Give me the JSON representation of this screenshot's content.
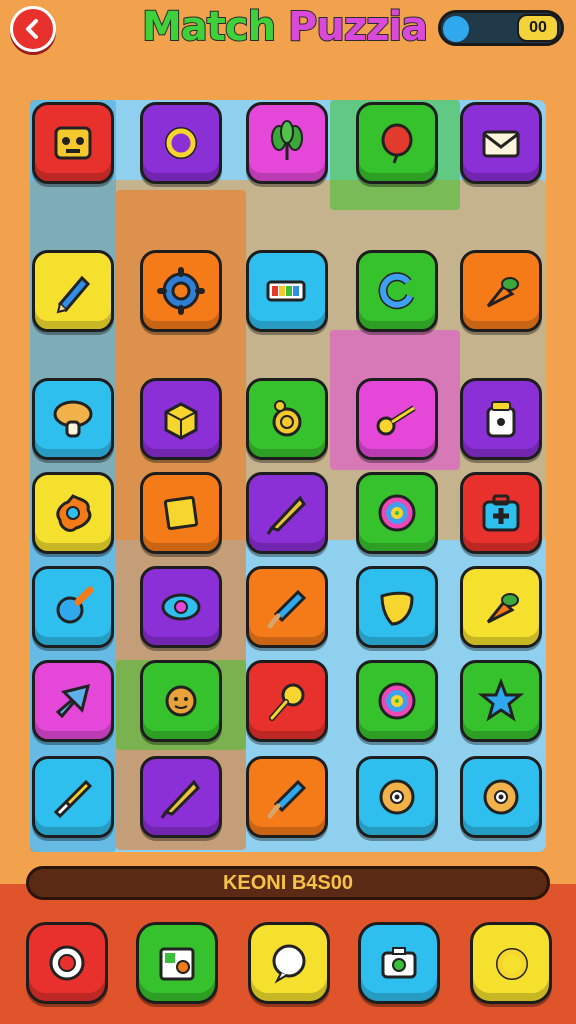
{
  "header": {
    "title_part1": "Match ",
    "title_part2": "Puzzia",
    "back_icon": "chevron-left-icon",
    "counter": "00",
    "progress_fraction": 0.1
  },
  "colors": {
    "red": "#e8312c",
    "purple": "#8b2fd6",
    "magenta": "#e548d9",
    "green": "#36c22c",
    "yellow": "#f5e02e",
    "cyan": "#2fbfee",
    "orange": "#f57a18",
    "pink": "#ef47b5"
  },
  "status_text": "KEONI B4S00",
  "tiles": [
    {
      "row": 0,
      "col": 0,
      "color": "red",
      "icon": "block-face-icon"
    },
    {
      "row": 0,
      "col": 1,
      "color": "purple",
      "icon": "ring-icon"
    },
    {
      "row": 0,
      "col": 2,
      "color": "magenta",
      "icon": "leaf-plant-icon"
    },
    {
      "row": 0,
      "col": 3,
      "color": "green",
      "icon": "balloon-icon"
    },
    {
      "row": 0,
      "col": 4,
      "color": "purple",
      "icon": "envelope-icon"
    },
    {
      "row": 1,
      "col": 0,
      "color": "yellow",
      "icon": "pencil-icon"
    },
    {
      "row": 1,
      "col": 1,
      "color": "orange",
      "icon": "gear-icon"
    },
    {
      "row": 1,
      "col": 2,
      "color": "cyan",
      "icon": "battery-icon"
    },
    {
      "row": 1,
      "col": 3,
      "color": "green",
      "icon": "swirl-c-icon"
    },
    {
      "row": 1,
      "col": 4,
      "color": "orange",
      "icon": "carrot-icon"
    },
    {
      "row": 2,
      "col": 0,
      "color": "cyan",
      "icon": "mushroom-icon"
    },
    {
      "row": 2,
      "col": 1,
      "color": "purple",
      "icon": "box-icon"
    },
    {
      "row": 2,
      "col": 2,
      "color": "green",
      "icon": "snail-icon"
    },
    {
      "row": 2,
      "col": 3,
      "color": "magenta",
      "icon": "key-icon"
    },
    {
      "row": 2,
      "col": 4,
      "color": "purple",
      "icon": "jar-icon"
    },
    {
      "row": 3,
      "col": 0,
      "color": "yellow",
      "icon": "splat-icon"
    },
    {
      "row": 3,
      "col": 1,
      "color": "orange",
      "icon": "note-icon"
    },
    {
      "row": 3,
      "col": 2,
      "color": "purple",
      "icon": "kite-icon"
    },
    {
      "row": 3,
      "col": 3,
      "color": "green",
      "icon": "lollipop-icon"
    },
    {
      "row": 3,
      "col": 4,
      "color": "red",
      "icon": "first-aid-icon"
    },
    {
      "row": 4,
      "col": 0,
      "color": "cyan",
      "icon": "pin-icon"
    },
    {
      "row": 4,
      "col": 1,
      "color": "purple",
      "icon": "eye-icon"
    },
    {
      "row": 4,
      "col": 2,
      "color": "orange",
      "icon": "popsicle-icon"
    },
    {
      "row": 4,
      "col": 3,
      "color": "cyan",
      "icon": "leaf-icon"
    },
    {
      "row": 4,
      "col": 4,
      "color": "yellow",
      "icon": "carrot-icon"
    },
    {
      "row": 5,
      "col": 0,
      "color": "magenta",
      "icon": "arrow-head-icon"
    },
    {
      "row": 5,
      "col": 1,
      "color": "green",
      "icon": "sun-face-icon"
    },
    {
      "row": 5,
      "col": 2,
      "color": "red",
      "icon": "rattle-icon"
    },
    {
      "row": 5,
      "col": 3,
      "color": "green",
      "icon": "lollipop-icon"
    },
    {
      "row": 5,
      "col": 4,
      "color": "green",
      "icon": "star-icon"
    },
    {
      "row": 6,
      "col": 0,
      "color": "cyan",
      "icon": "brush-icon"
    },
    {
      "row": 6,
      "col": 1,
      "color": "purple",
      "icon": "kite-icon"
    },
    {
      "row": 6,
      "col": 2,
      "color": "orange",
      "icon": "popsicle-icon"
    },
    {
      "row": 6,
      "col": 3,
      "color": "cyan",
      "icon": "cookie-icon"
    },
    {
      "row": 6,
      "col": 4,
      "color": "cyan",
      "icon": "cookie-icon"
    }
  ],
  "powerups": [
    {
      "color": "red",
      "icon": "target-icon"
    },
    {
      "color": "green",
      "icon": "film-icon"
    },
    {
      "color": "yellow",
      "icon": "bubble-icon"
    },
    {
      "color": "cyan",
      "icon": "camera-icon"
    },
    {
      "color": "yellow",
      "icon": "ring-icon"
    }
  ]
}
